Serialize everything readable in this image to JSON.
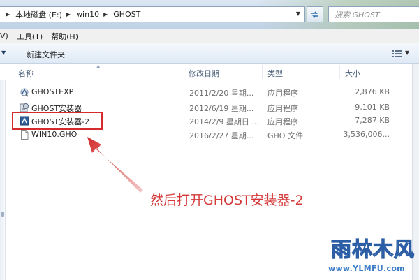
{
  "address": {
    "crumbs": [
      "本地磁盘 (E:)",
      "win10",
      "GHOST"
    ],
    "search_placeholder": "搜索 GHOST"
  },
  "menu": {
    "partial_first": "V)",
    "items": [
      "工具(T)",
      "帮助(H)"
    ]
  },
  "toolbar": {
    "new_folder": "新建文件夹"
  },
  "columns": [
    "名称",
    "修改日期",
    "类型",
    "大小"
  ],
  "files": [
    {
      "name": "GHOSTEXP",
      "date": "2011/2/20 星期...",
      "type": "应用程序",
      "size": "2,876 KB",
      "icon": "ghost-exe-icon"
    },
    {
      "name": "GHOST安装器",
      "date": "2012/6/19 星期...",
      "type": "应用程序",
      "size": "9,101 KB",
      "icon": "installer-icon"
    },
    {
      "name": "GHOST安装器-2",
      "date": "2014/2/9 星期日 ...",
      "type": "应用程序",
      "size": "7,287 KB",
      "icon": "installer-2-icon"
    },
    {
      "name": "WIN10.GHO",
      "date": "2016/2/27 星期...",
      "type": "GHO 文件",
      "size": "3,536,006...",
      "icon": "blank-file-icon"
    }
  ],
  "annotation": {
    "caption": "然后打开GHOST安装器-2",
    "color": "#d42c2c"
  },
  "watermark": {
    "title": "雨林木风",
    "url": "www.YLMFU.com"
  }
}
